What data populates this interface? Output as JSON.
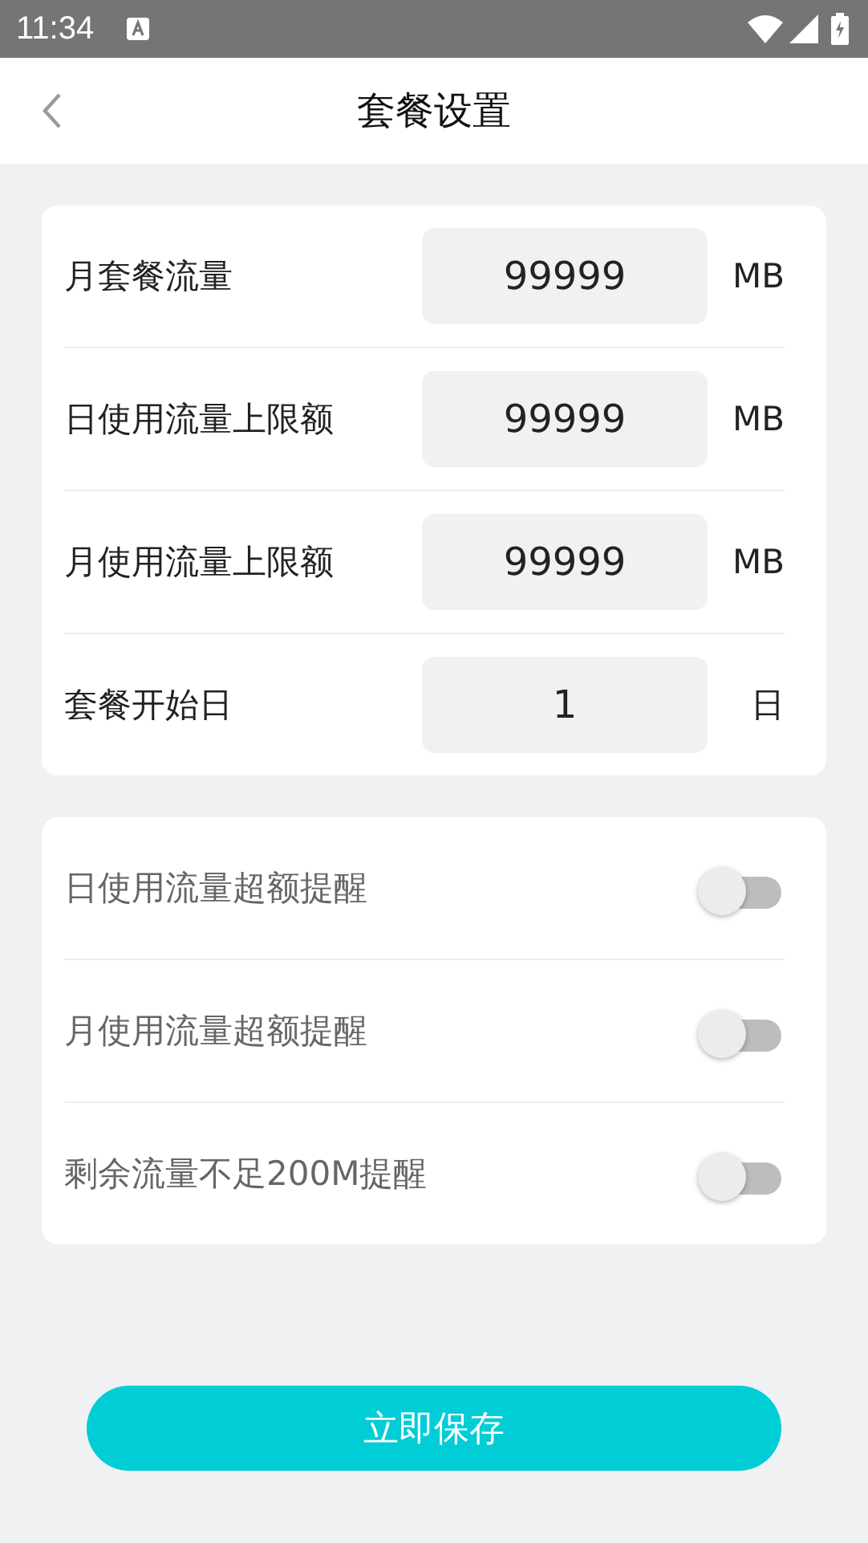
{
  "status_bar": {
    "time": "11:34"
  },
  "header": {
    "title": "套餐设置"
  },
  "limits": [
    {
      "label": "月套餐流量",
      "value": "99999",
      "unit": "MB"
    },
    {
      "label": "日使用流量上限额",
      "value": "99999",
      "unit": "MB"
    },
    {
      "label": "月使用流量上限额",
      "value": "99999",
      "unit": "MB"
    },
    {
      "label": "套餐开始日",
      "value": "1",
      "unit": "日"
    }
  ],
  "reminders": [
    {
      "label": "日使用流量超额提醒",
      "on": false
    },
    {
      "label": "月使用流量超额提醒",
      "on": false
    },
    {
      "label": "剩余流量不足200M提醒",
      "on": false
    }
  ],
  "save_button": "立即保存"
}
